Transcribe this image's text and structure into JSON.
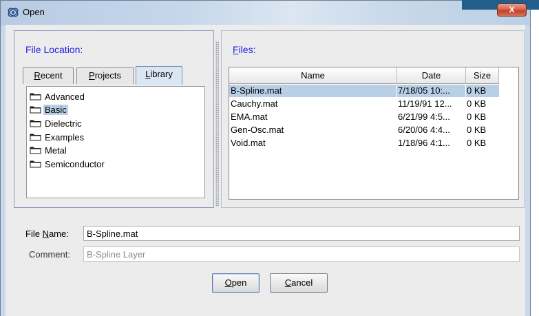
{
  "window": {
    "title": "Open",
    "close_glyph": "X"
  },
  "left": {
    "label": "File Location:",
    "tabs": [
      {
        "mnemonic": "R",
        "rest": "ecent",
        "active": false
      },
      {
        "mnemonic": "P",
        "rest": "rojects",
        "active": false
      },
      {
        "mnemonic": "L",
        "rest": "ibrary",
        "active": true
      }
    ],
    "folders": [
      "Advanced",
      "Basic",
      "Dielectric",
      "Examples",
      "Metal",
      "Semiconductor"
    ],
    "selected_folder_index": 1
  },
  "right": {
    "label_mnemonic": "F",
    "label_rest": "iles:",
    "columns": [
      "Name",
      "Date",
      "Size"
    ],
    "rows": [
      {
        "name": "B-Spline.mat",
        "date": "7/18/05 10:...",
        "size": "0 KB",
        "selected": true
      },
      {
        "name": "Cauchy.mat",
        "date": "11/19/91 12...",
        "size": "0 KB",
        "selected": false
      },
      {
        "name": "EMA.mat",
        "date": "6/21/99 4:5...",
        "size": "0 KB",
        "selected": false
      },
      {
        "name": "Gen-Osc.mat",
        "date": "6/20/06 4:4...",
        "size": "0 KB",
        "selected": false
      },
      {
        "name": "Void.mat",
        "date": "1/18/96 4:1...",
        "size": "0 KB",
        "selected": false
      }
    ]
  },
  "form": {
    "file_name_label_pre": "File ",
    "file_name_label_mnemonic": "N",
    "file_name_label_post": "ame:",
    "file_name_value": "B-Spline.mat",
    "comment_label": "Comment:",
    "comment_value": "B-Spline Layer"
  },
  "buttons": {
    "open_mnemonic": "O",
    "open_rest": "pen",
    "cancel_mnemonic": "C",
    "cancel_rest": "ancel"
  },
  "colors": {
    "accent_label": "#1d1de6",
    "selection": "#b9cfe6",
    "title_bar": "#c6d7ea",
    "close": "#c1412a"
  },
  "icons": {
    "app": "open-dialog-icon",
    "folder": "folder-icon",
    "close": "close-icon"
  }
}
